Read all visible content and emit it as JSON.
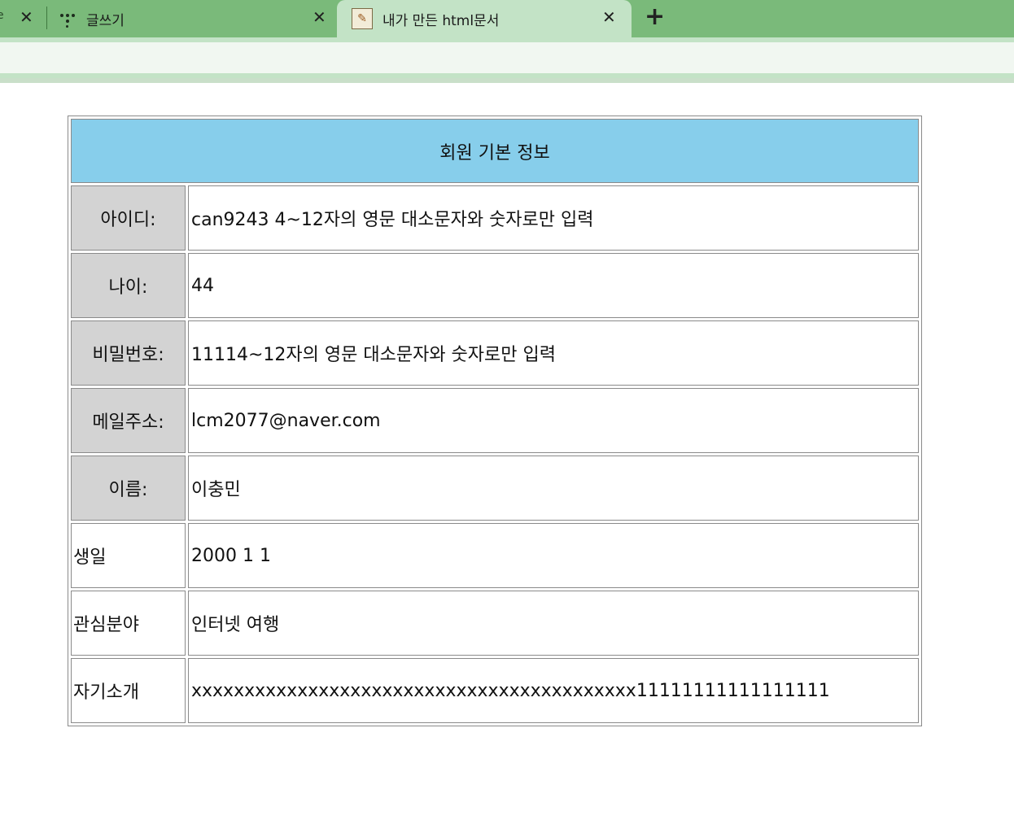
{
  "browser": {
    "tabs": [
      {
        "label": "e",
        "partial": true
      },
      {
        "label": "글쓰기",
        "icon": "dots-logo-icon"
      },
      {
        "label": "내가 만든 html문서",
        "icon": "document-favicon-icon",
        "active": true
      }
    ],
    "close_glyph": "✕",
    "new_tab_glyph": "+"
  },
  "table": {
    "header": "회원 기본 정보",
    "rows": [
      {
        "label": "아이디:",
        "value": "can9243 4~12자의 영문 대소문자와 숫자로만 입력",
        "shaded": true
      },
      {
        "label": "나이:",
        "value": "44",
        "shaded": true
      },
      {
        "label": "비밀번호:",
        "value": "11114~12자의 영문 대소문자와 숫자로만 입력",
        "shaded": true
      },
      {
        "label": "메일주소:",
        "value": "lcm2077@naver.com",
        "shaded": true
      },
      {
        "label": "이름:",
        "value": "이충민",
        "shaded": true
      },
      {
        "label": "생일",
        "value": "2000 1 1",
        "shaded": false
      },
      {
        "label": "관심분야",
        "value": "인터넷 여행",
        "shaded": false
      },
      {
        "label": "자기소개",
        "value": "xxxxxxxxxxxxxxxxxxxxxxxxxxxxxxxxxxxxxxxxxx11111111111111111",
        "shaded": false
      }
    ]
  },
  "colors": {
    "tab_strip": "#7aba7a",
    "active_tab": "#c3e3c6",
    "header_bg": "#87ceeb",
    "label_bg": "#d3d3d3"
  }
}
